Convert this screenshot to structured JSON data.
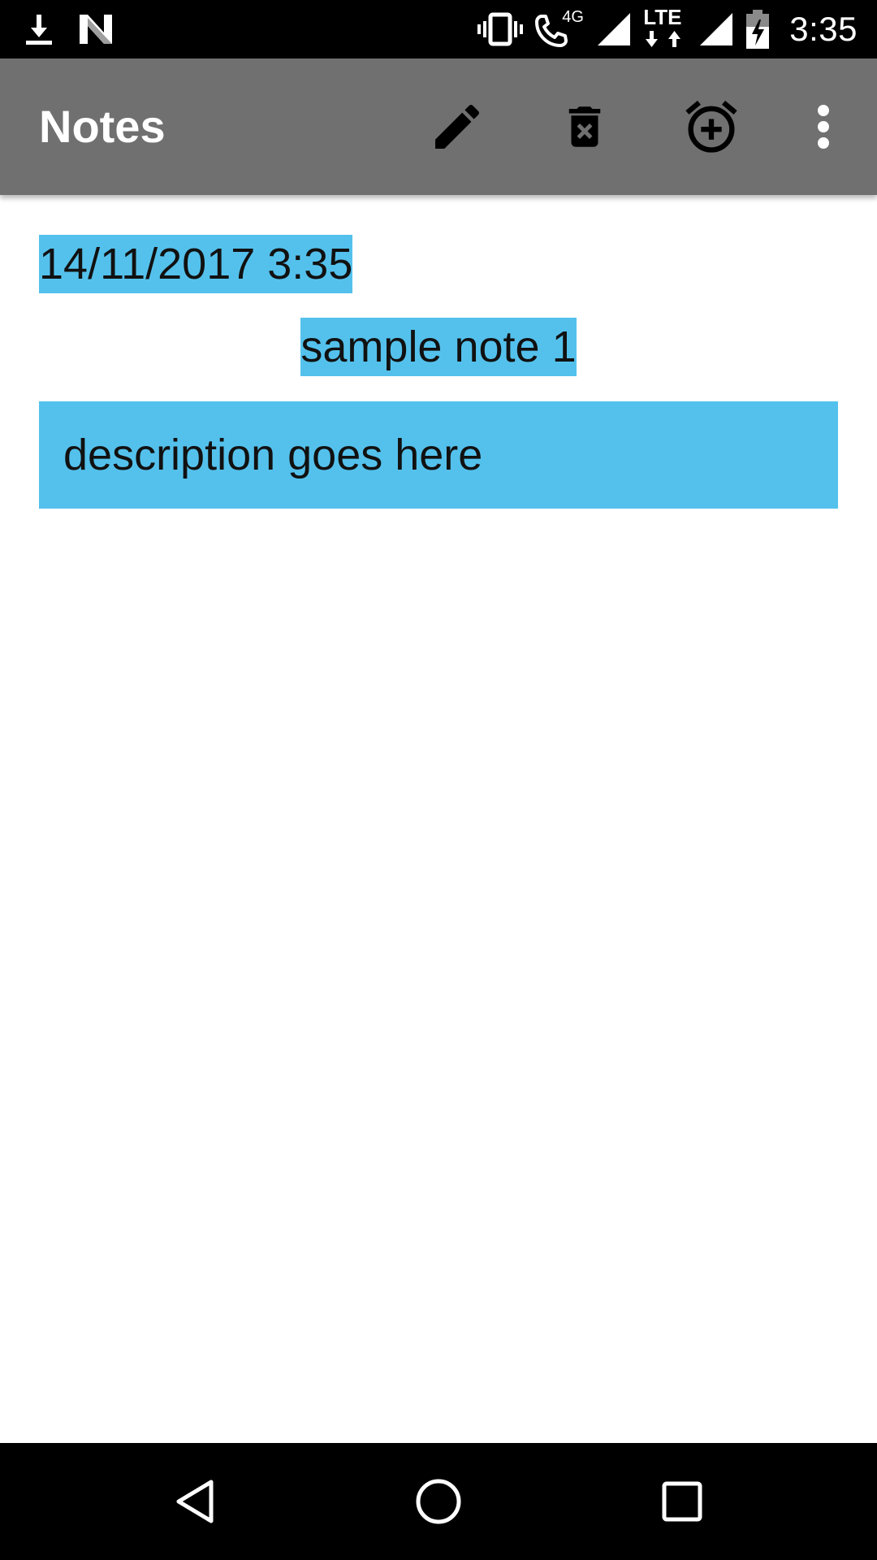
{
  "status_bar": {
    "time": "3:35",
    "network_label": "4G",
    "lte_label": "LTE",
    "left_icons": [
      "download-icon",
      "n-logo-icon"
    ],
    "right_icons": [
      "vibrate-icon",
      "wifi-call-icon",
      "signal-icon",
      "lte-icon",
      "signal-icon",
      "battery-charging-icon"
    ]
  },
  "toolbar": {
    "title": "Notes",
    "actions": [
      "edit-icon",
      "delete-icon",
      "add-alarm-icon",
      "more-vert-icon"
    ]
  },
  "note": {
    "date": "14/11/2017 3:35",
    "title": "sample note 1",
    "description": "description goes here"
  },
  "colors": {
    "toolbar_bg": "#707070",
    "field_highlight": "#54c1ec",
    "status_bar_bg": "#000000",
    "nav_bar_bg": "#000000"
  },
  "nav_bar": {
    "buttons": [
      "back-icon",
      "home-icon",
      "recents-icon"
    ]
  }
}
